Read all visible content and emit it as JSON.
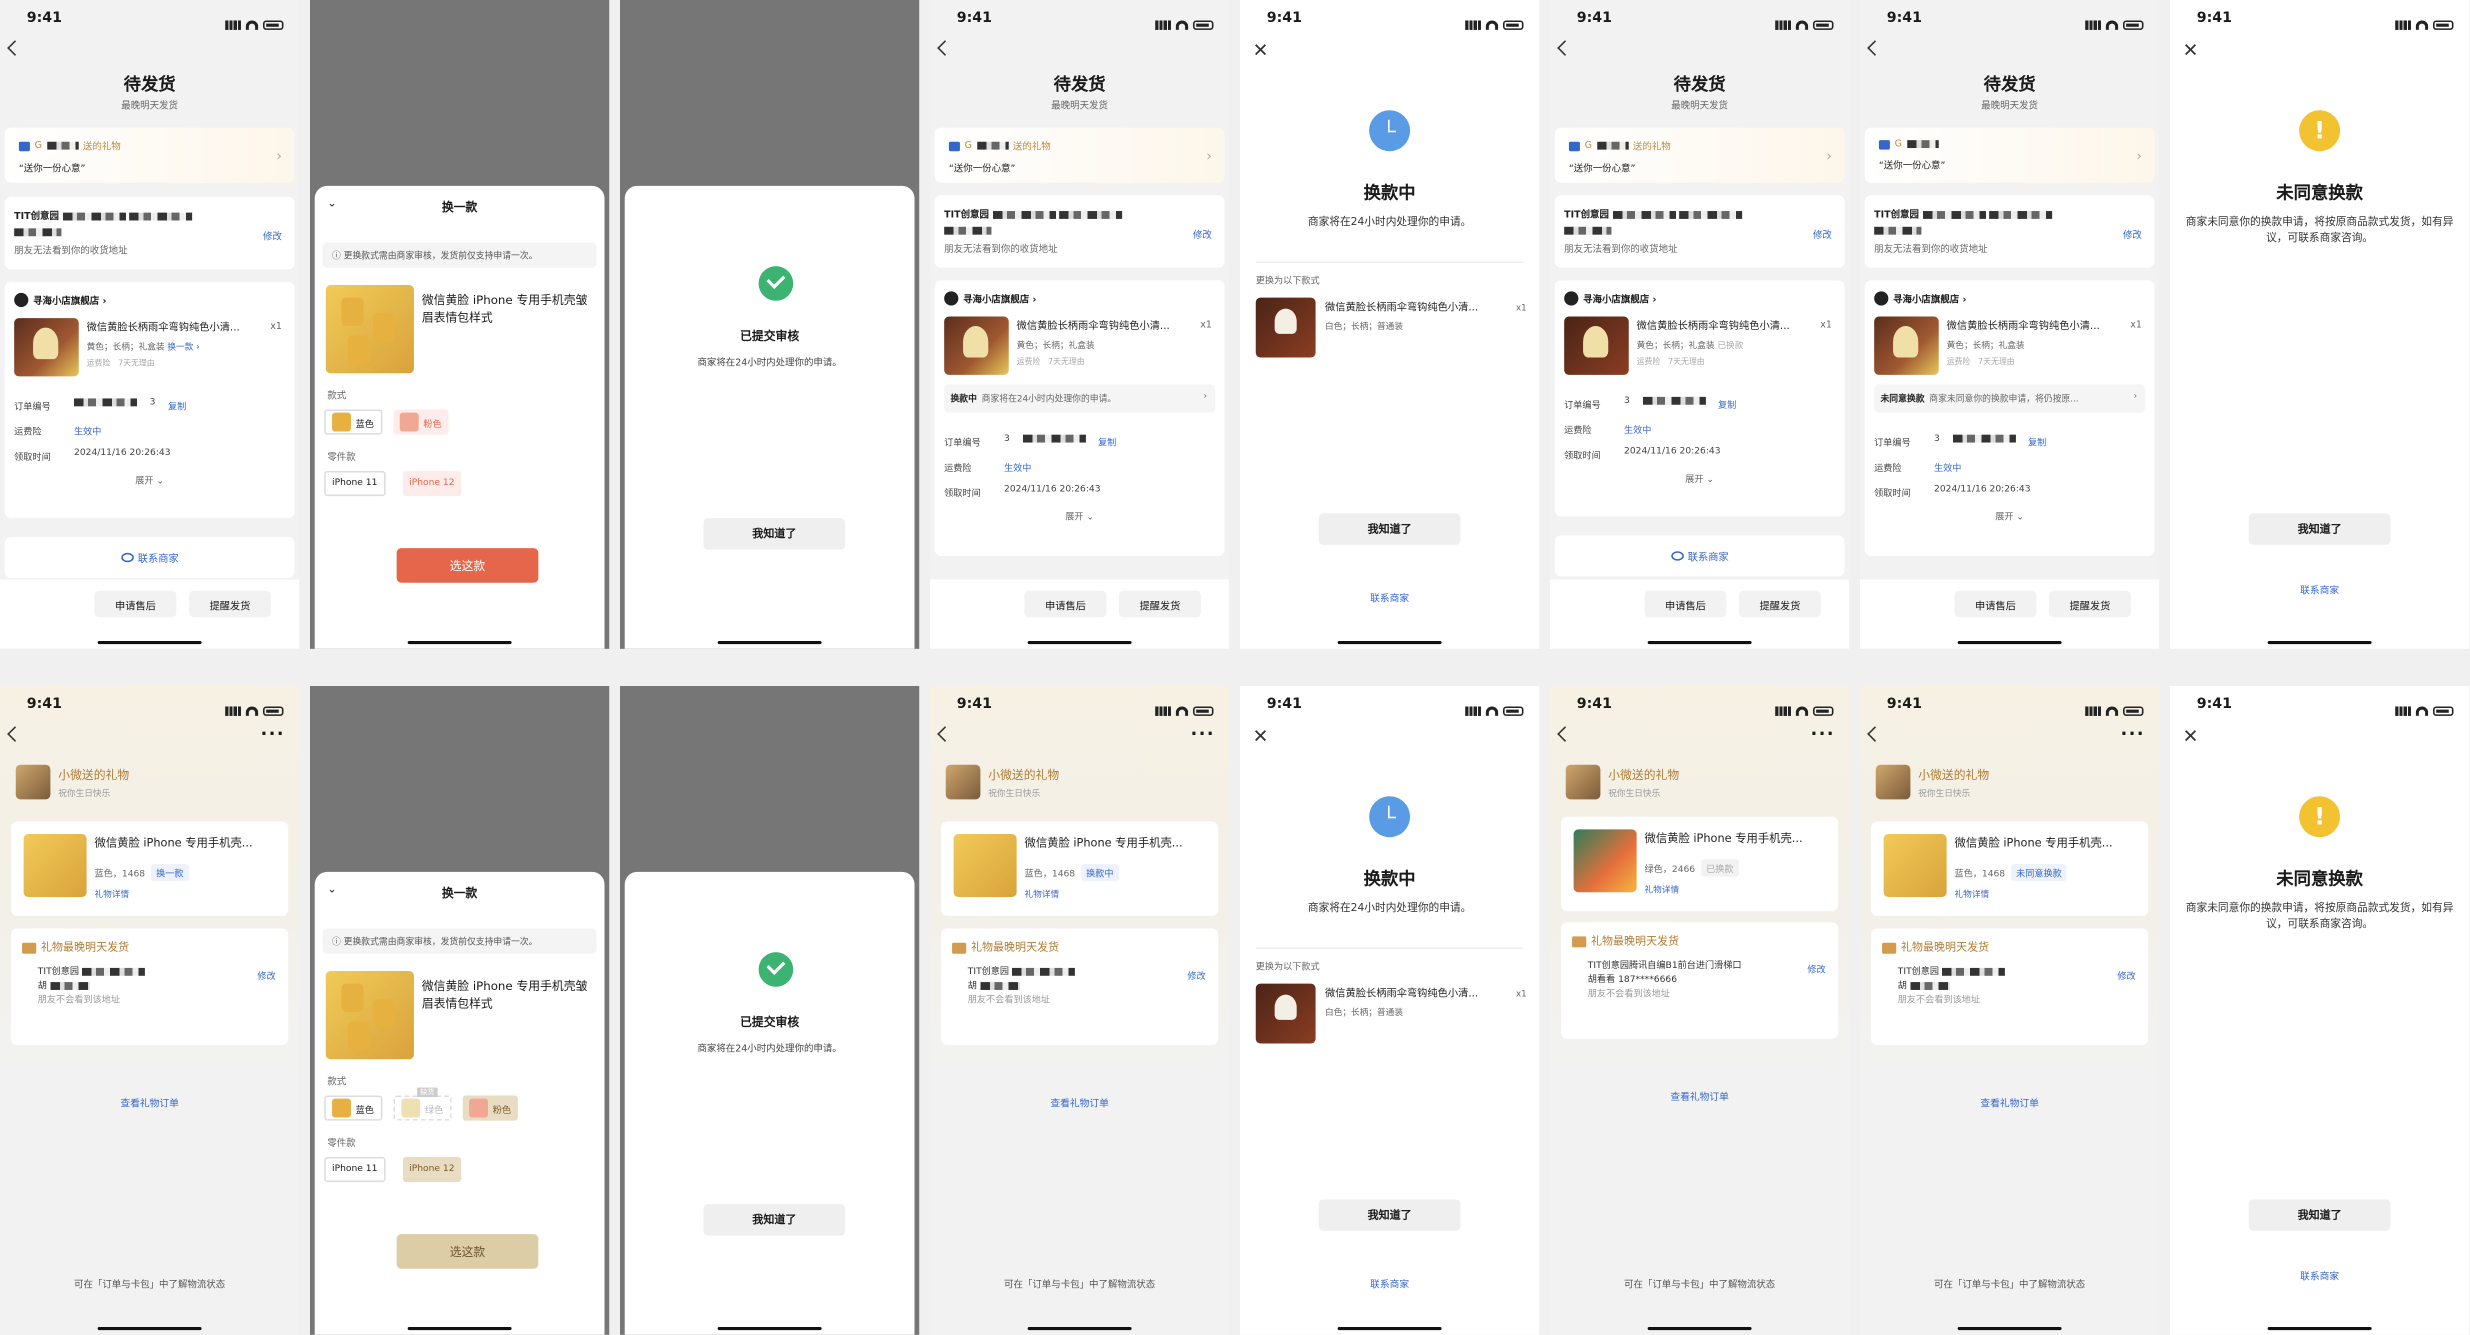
{
  "status_time": "9:41",
  "order": {
    "title": "待发货",
    "subtitle": "最晚明天发货",
    "gift_line": "送的礼物",
    "gift_line_prefix": "G",
    "gift_quote": "“送你一份心意”",
    "addr_name": "TIT创意园",
    "addr_edit": "修改",
    "addr_tip": "朋友无法看到你的收货地址",
    "shop_name": "寻海小店旗舰店 ›",
    "product_title": "微信黄脸长柄雨伞弯钩纯色小清...",
    "product_qty": "x1",
    "product_spec": "黄色；长柄；礼盒装",
    "product_change": "换一款 ›",
    "product_spec_waiting": "黄色；长柄；礼盒装",
    "product_changed_tag": "已换款",
    "product_policy": "运费险　7天无理由",
    "status_exchanging_label": "换款中",
    "status_exchanging_text": "商家将在24小时内处理你的申请。",
    "status_rejected_label": "未同意换款",
    "status_rejected_text": "商家未同意你的换款申请，将仍按原...",
    "label_order_no": "订单编号",
    "label_insurance": "运费险",
    "label_time": "领取时间",
    "order_no_suffix": "3",
    "copy": "复制",
    "insurance_value": "生效中",
    "time_value": "2024/11/16  20:26:43",
    "expand": "展开 ⌄",
    "contact": "联系商家",
    "btn_aftersale": "申请售后",
    "btn_remind": "提醒发货"
  },
  "exchange_sheet": {
    "title": "换一款",
    "notice": "更换款式需由商家审核，发货前仅支持申请一次。",
    "product_title": "微信黄脸 iPhone 专用手机壳皱眉表情包样式",
    "label_style": "款式",
    "label_part": "零件款",
    "opt_blue": "蓝色",
    "opt_pink": "粉色",
    "opt_green": "绿色",
    "opt_sold_out": "缺货",
    "opt_iphone11": "iPhone 11",
    "opt_iphone12": "iPhone 12",
    "select_button": "选这款",
    "collapse_icon": "chevron-down-icon"
  },
  "submitted": {
    "title": "已提交审核",
    "subtitle": "商家将在24小时内处理你的申请。",
    "button": "我知道了"
  },
  "exchanging": {
    "title": "换款中",
    "subtitle": "商家将在24小时内处理你的申请。",
    "change_to_label": "更换为以下款式",
    "product_title": "微信黄脸长柄雨伞弯钩纯色小清...",
    "product_spec": "白色；长柄；普通装",
    "product_qty": "x1",
    "button": "我知道了",
    "contact": "联系商家"
  },
  "rejected": {
    "title": "未同意换款",
    "subtitle": "商家未同意你的换款申请，将按原商品款式发货，如有异议，可联系商家咨询。",
    "button": "我知道了",
    "contact": "联系商家"
  },
  "gift": {
    "sender_name": "小微送的礼物",
    "sender_sub": "祝你生日快乐",
    "product_title": "微信黄脸 iPhone 专用手机壳...",
    "product_title_alt": "微信黄脸 iPhone 专用手机壳...",
    "spec_blue": "蓝色，1468",
    "spec_green": "绿色，2466",
    "tag_change": "换一款",
    "tag_exchanging": "换款中",
    "tag_changed": "已换款",
    "tag_rejected": "未同意换款",
    "detail_link": "礼物详情",
    "ship_title": "礼物最晚明天发货",
    "ship_name": "TIT创意园",
    "ship_name_full": "TIT创意园腾讯自编B1前台进门滑梯口",
    "ship_phone_prefix": "胡",
    "ship_phone_full": "胡看看  187****6666",
    "ship_tip": "朋友不会看到该地址",
    "ship_edit": "修改",
    "view_order": "查看礼物订单",
    "footer": "可在「订单与卡包」中了解物流状态"
  }
}
